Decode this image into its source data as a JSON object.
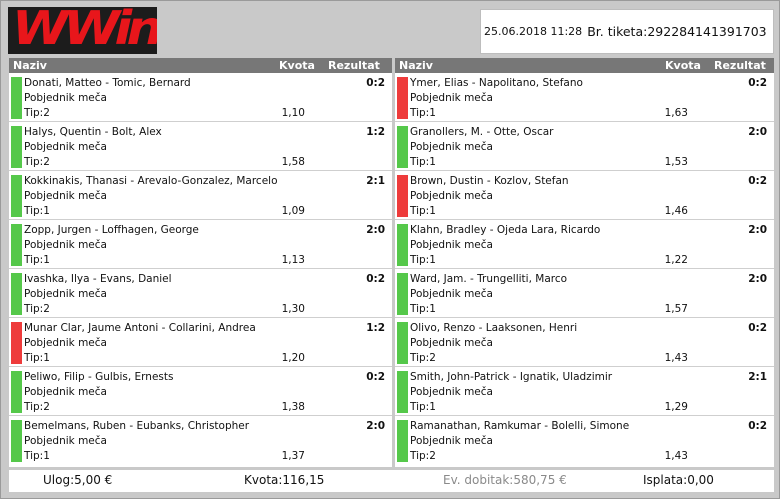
{
  "brand": "WWin",
  "ticket": {
    "date": "25.06.2018 11:28",
    "label": "Br. tiketa:",
    "number": "292284141391703"
  },
  "columns": {
    "name": "Naziv",
    "odds": "Kvota",
    "result": "Rezultat"
  },
  "colors": {
    "win": "#55c84a",
    "loss": "#ee3b3b",
    "header": "#777777"
  },
  "left": [
    {
      "match": "Donati, Matteo - Tomic, Bernard",
      "market": "Pobjednik meča",
      "tip": "Tip:2",
      "odds": "1,10",
      "result": "0:2",
      "status": "win"
    },
    {
      "match": "Halys, Quentin - Bolt, Alex",
      "market": "Pobjednik meča",
      "tip": "Tip:2",
      "odds": "1,58",
      "result": "1:2",
      "status": "win"
    },
    {
      "match": "Kokkinakis, Thanasi - Arevalo-Gonzalez, Marcelo",
      "market": "Pobjednik meča",
      "tip": "Tip:1",
      "odds": "1,09",
      "result": "2:1",
      "status": "win"
    },
    {
      "match": "Zopp, Jurgen - Loffhagen, George",
      "market": "Pobjednik meča",
      "tip": "Tip:1",
      "odds": "1,13",
      "result": "2:0",
      "status": "win"
    },
    {
      "match": "Ivashka, Ilya - Evans, Daniel",
      "market": "Pobjednik meča",
      "tip": "Tip:2",
      "odds": "1,30",
      "result": "0:2",
      "status": "win"
    },
    {
      "match": "Munar Clar, Jaume Antoni - Collarini, Andrea",
      "market": "Pobjednik meča",
      "tip": "Tip:1",
      "odds": "1,20",
      "result": "1:2",
      "status": "loss"
    },
    {
      "match": "Peliwo, Filip - Gulbis, Ernests",
      "market": "Pobjednik meča",
      "tip": "Tip:2",
      "odds": "1,38",
      "result": "0:2",
      "status": "win"
    },
    {
      "match": "Bemelmans, Ruben - Eubanks, Christopher",
      "market": "Pobjednik meča",
      "tip": "Tip:1",
      "odds": "1,37",
      "result": "2:0",
      "status": "win"
    }
  ],
  "right": [
    {
      "match": "Ymer, Elias - Napolitano, Stefano",
      "market": "Pobjednik meča",
      "tip": "Tip:1",
      "odds": "1,63",
      "result": "0:2",
      "status": "loss"
    },
    {
      "match": "Granollers, M. - Otte, Oscar",
      "market": "Pobjednik meča",
      "tip": "Tip:1",
      "odds": "1,53",
      "result": "2:0",
      "status": "win"
    },
    {
      "match": "Brown, Dustin - Kozlov, Stefan",
      "market": "Pobjednik meča",
      "tip": "Tip:1",
      "odds": "1,46",
      "result": "0:2",
      "status": "loss"
    },
    {
      "match": "Klahn, Bradley - Ojeda Lara, Ricardo",
      "market": "Pobjednik meča",
      "tip": "Tip:1",
      "odds": "1,22",
      "result": "2:0",
      "status": "win"
    },
    {
      "match": "Ward, Jam. - Trungelliti, Marco",
      "market": "Pobjednik meča",
      "tip": "Tip:1",
      "odds": "1,57",
      "result": "2:0",
      "status": "win"
    },
    {
      "match": "Olivo, Renzo - Laaksonen, Henri",
      "market": "Pobjednik meča",
      "tip": "Tip:2",
      "odds": "1,43",
      "result": "0:2",
      "status": "win"
    },
    {
      "match": "Smith, John-Patrick - Ignatik, Uladzimir",
      "market": "Pobjednik meča",
      "tip": "Tip:1",
      "odds": "1,29",
      "result": "2:1",
      "status": "win"
    },
    {
      "match": "Ramanathan, Ramkumar - Bolelli, Simone",
      "market": "Pobjednik meča",
      "tip": "Tip:2",
      "odds": "1,43",
      "result": "0:2",
      "status": "win"
    }
  ],
  "footer": {
    "stake": "Ulog:5,00 €",
    "total_odds": "Kvota:116,15",
    "potential_win": "Ev. dobitak:580,75 €",
    "payout": "Isplata:0,00"
  }
}
